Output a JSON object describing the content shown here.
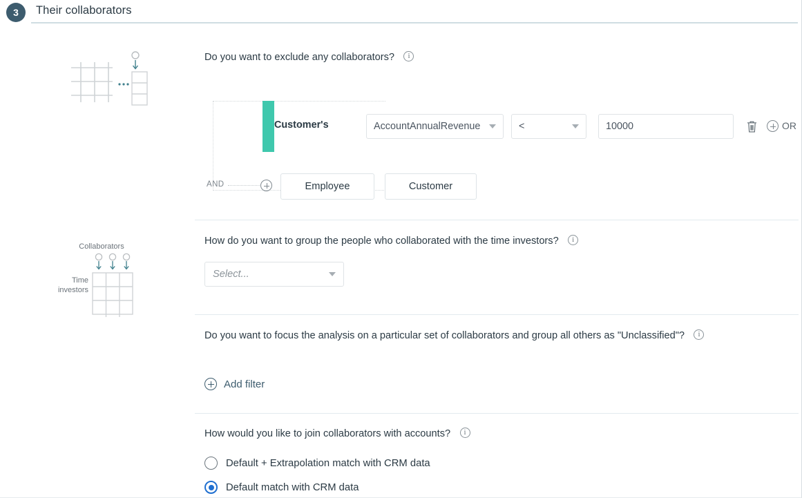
{
  "header": {
    "step_number": "3",
    "title": "Their collaborators"
  },
  "illustration_1": {
    "alt": "grid-to-column-diagram"
  },
  "illustration_2": {
    "top_label": "Collaborators",
    "left_label_line1": "Time",
    "left_label_line2": "investors"
  },
  "section_exclude": {
    "question": "Do you want to exclude any collaborators?",
    "info_icon": "info-icon",
    "entity_label": "Customer's",
    "field_select": {
      "value": "AccountAnnualRevenue",
      "caret": "chevron-down-icon"
    },
    "operator_select": {
      "value": "<",
      "caret": "chevron-down-icon"
    },
    "value_input": {
      "value": "10000",
      "placeholder": ""
    },
    "delete_icon": "trash-icon",
    "add_icon": "plus-circle-icon",
    "or_label": "OR",
    "and_label": "AND",
    "and_add_icon": "plus-circle-icon",
    "buttons": [
      {
        "label": "Employee"
      },
      {
        "label": "Customer"
      }
    ]
  },
  "section_group": {
    "question": "How do you want to group the people who collaborated with the time investors?",
    "info_icon": "info-icon",
    "select_placeholder": "Select...",
    "caret": "chevron-down-icon"
  },
  "section_focus": {
    "question": "Do you want to focus the analysis on a particular set of collaborators and group all others as \"Unclassified\"?",
    "info_icon": "info-icon",
    "add_filter_label": "Add filter",
    "add_filter_icon": "plus-circle-icon"
  },
  "section_join": {
    "question": "How would you like to join collaborators with accounts?",
    "info_icon": "info-icon",
    "options": [
      {
        "label": "Default + Extrapolation match with CRM data",
        "selected": false
      },
      {
        "label": "Default match with CRM data",
        "selected": true
      }
    ]
  },
  "colors": {
    "badge": "#3d5c6e",
    "teal_bar": "#3fc8ad",
    "accent_link": "#3d5c6e",
    "radio_selected": "#1f6fd0",
    "divider": "#e2eaee",
    "header_rule": "#cfdde2"
  }
}
